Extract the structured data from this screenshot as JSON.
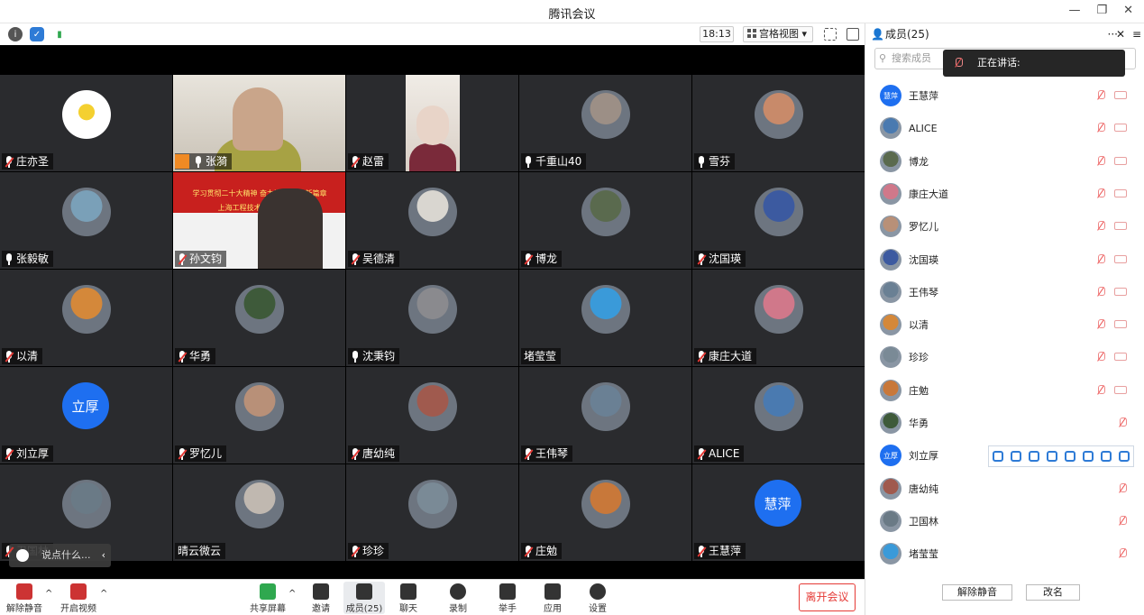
{
  "window": {
    "title": "腾讯会议"
  },
  "toolbar_top": {
    "time": "18:13",
    "view_mode": "宫格视图"
  },
  "tiles": [
    {
      "name": "庄亦圣",
      "muted": true,
      "bg": "#2a2b2e",
      "av": "#f2f2f2",
      "type": "avatar"
    },
    {
      "name": "张漪",
      "muted": false,
      "bg": "#d8d4cc",
      "av": "#c9b8a6",
      "type": "video",
      "host": true
    },
    {
      "name": "赵雷",
      "muted": true,
      "bg": "#2a2b2e",
      "av": "#e0d0c6",
      "type": "video2"
    },
    {
      "name": "千重山40",
      "muted": false,
      "bg": "#2a2b2e",
      "av": "#9c8f86",
      "type": "avatar"
    },
    {
      "name": "雪芬",
      "muted": false,
      "bg": "#2a2b2e",
      "av": "#c88a6a",
      "type": "avatar"
    },
    {
      "name": "张毅敏",
      "muted": false,
      "bg": "#2a2b2e",
      "av": "#7aa0b8",
      "type": "avatar"
    },
    {
      "name": "孙文钧",
      "muted": true,
      "bg": "#c8201e",
      "av": "#3a3a3a",
      "type": "video3"
    },
    {
      "name": "吴德清",
      "muted": true,
      "bg": "#2a2b2e",
      "av": "#d9d6d0",
      "type": "avatar"
    },
    {
      "name": "博龙",
      "muted": true,
      "bg": "#2a2b2e",
      "av": "#5a6a4e",
      "type": "avatar"
    },
    {
      "name": "沈国瑛",
      "muted": true,
      "bg": "#2a2b2e",
      "av": "#3c5aa0",
      "type": "avatar"
    },
    {
      "name": "以清",
      "muted": true,
      "bg": "#2a2b2e",
      "av": "#d4883a",
      "type": "avatar"
    },
    {
      "name": "华勇",
      "muted": true,
      "bg": "#2a2b2e",
      "av": "#3e5a3a",
      "type": "avatar"
    },
    {
      "name": "沈秉钧",
      "muted": false,
      "bg": "#2a2b2e",
      "av": "#8a8a8e",
      "type": "avatar"
    },
    {
      "name": "堵莹莹",
      "muted": null,
      "bg": "#2a2b2e",
      "av": "#3a9ad9",
      "type": "avatar"
    },
    {
      "name": "康庄大道",
      "muted": true,
      "bg": "#2a2b2e",
      "av": "#d0788a",
      "type": "avatar"
    },
    {
      "name": "刘立厚",
      "muted": true,
      "bg": "#2a2b2e",
      "av": "#1e6ff0",
      "type": "initials",
      "initials": "立厚"
    },
    {
      "name": "罗忆儿",
      "muted": true,
      "bg": "#2a2b2e",
      "av": "#b89078",
      "type": "avatar"
    },
    {
      "name": "唐幼纯",
      "muted": true,
      "bg": "#2a2b2e",
      "av": "#a05a4e",
      "type": "avatar"
    },
    {
      "name": "王伟琴",
      "muted": true,
      "bg": "#2a2b2e",
      "av": "#6a8094",
      "type": "avatar"
    },
    {
      "name": "ALICE",
      "muted": true,
      "bg": "#2a2b2e",
      "av": "#4a7ab0",
      "type": "avatar"
    },
    {
      "name": "卫国林",
      "muted": true,
      "bg": "#2a2b2e",
      "av": "#6a7a86",
      "type": "avatar"
    },
    {
      "name": "晴云微云",
      "muted": null,
      "bg": "#2a2b2e",
      "av": "#c0b8b0",
      "type": "avatar"
    },
    {
      "name": "珍珍",
      "muted": true,
      "bg": "#2a2b2e",
      "av": "#7a8a96",
      "type": "avatar"
    },
    {
      "name": "庄勉",
      "muted": true,
      "bg": "#2a2b2e",
      "av": "#c8783a",
      "type": "avatar"
    },
    {
      "name": "王慧萍",
      "muted": true,
      "bg": "#2a2b2e",
      "av": "#1e6ff0",
      "type": "initials",
      "initials": "慧萍"
    }
  ],
  "chat_popup": {
    "placeholder": "说点什么..."
  },
  "bottom_bar": {
    "unmute": "解除静音",
    "start_video": "开启视频",
    "share_screen": "共享屏幕",
    "invite": "邀请",
    "members": "成员(25)",
    "chat": "聊天",
    "record": "录制",
    "raise_hand": "举手",
    "apps": "应用",
    "settings": "设置",
    "leave": "离开会议"
  },
  "panel": {
    "title": "成员(25)",
    "search_placeholder": "搜索成员",
    "speaking_label": "正在讲话:",
    "members": [
      {
        "name": "王慧萍",
        "initials": "慧萍",
        "color": "#1e6ff0",
        "video": true
      },
      {
        "name": "ALICE",
        "color": "#4a7ab0",
        "video": true
      },
      {
        "name": "博龙",
        "color": "#5a6a4e",
        "video": true
      },
      {
        "name": "康庄大道",
        "color": "#d0788a",
        "video": true
      },
      {
        "name": "罗忆儿",
        "color": "#b89078",
        "video": true
      },
      {
        "name": "沈国瑛",
        "color": "#3c5aa0",
        "video": true
      },
      {
        "name": "王伟琴",
        "color": "#6a8094",
        "video": true
      },
      {
        "name": "以清",
        "color": "#d4883a",
        "video": true
      },
      {
        "name": "珍珍",
        "color": "#7a8a96",
        "video": true
      },
      {
        "name": "庄勉",
        "color": "#c8783a",
        "video": true
      },
      {
        "name": "华勇",
        "color": "#3e5a3a",
        "video": false
      },
      {
        "name": "刘立厚",
        "initials": "立厚",
        "color": "#1e6ff0",
        "video": false
      },
      {
        "name": "唐幼纯",
        "color": "#a05a4e",
        "video": false
      },
      {
        "name": "卫国林",
        "color": "#6a7a86",
        "video": false
      },
      {
        "name": "堵莹莹",
        "color": "#3a9ad9",
        "video": false
      }
    ],
    "unmute_button": "解除静音",
    "rename_button": "改名"
  },
  "video_banner": {
    "line1": "学习贯彻二十大精神 奋力谱写 工作新篇章",
    "line2": "上海工程技术大学20 会议"
  }
}
